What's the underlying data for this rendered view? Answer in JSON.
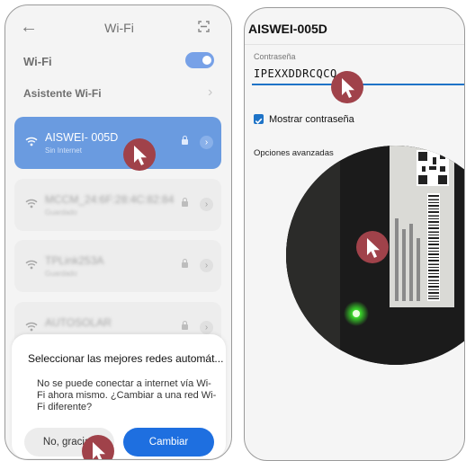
{
  "wifi_screen": {
    "title": "Wi-Fi",
    "back_icon": "back-arrow-icon",
    "scan_icon": "qr-scan-icon",
    "wifi_toggle_label": "Wi-Fi",
    "wifi_enabled": true,
    "assistant_label": "Asistente Wi-Fi",
    "networks": [
      {
        "name": "AISWEI- 005D",
        "status": "Sin Internet",
        "selected": true
      },
      {
        "name": "MCCM_24:6F:28:4C:82:84",
        "status": "Guardado",
        "selected": false
      },
      {
        "name": "TPLink253A",
        "status": "Guardado",
        "selected": false
      },
      {
        "name": "AUTOSOLAR",
        "status": "",
        "selected": false
      }
    ],
    "dialog": {
      "title": "Seleccionar las mejores redes automát...",
      "body": "No se puede conectar a internet vía Wi-Fi ahora mismo. ¿Cambiar a una red Wi-Fi diferente?",
      "no_label": "No, gracias",
      "yes_label": "Cambiar"
    }
  },
  "password_screen": {
    "title": "AISWEI-005D",
    "password_label": "Contraseña",
    "password_value": "IPEXXDDRCQCQ",
    "show_password_label": "Mostrar contraseña",
    "show_password_checked": true,
    "advanced_label": "Opciones avanzadas"
  },
  "colors": {
    "accent": "#1e6fe0",
    "selected_network": "#1b66cf",
    "cursor_badge": "#a0424a",
    "led": "#39d22a"
  }
}
